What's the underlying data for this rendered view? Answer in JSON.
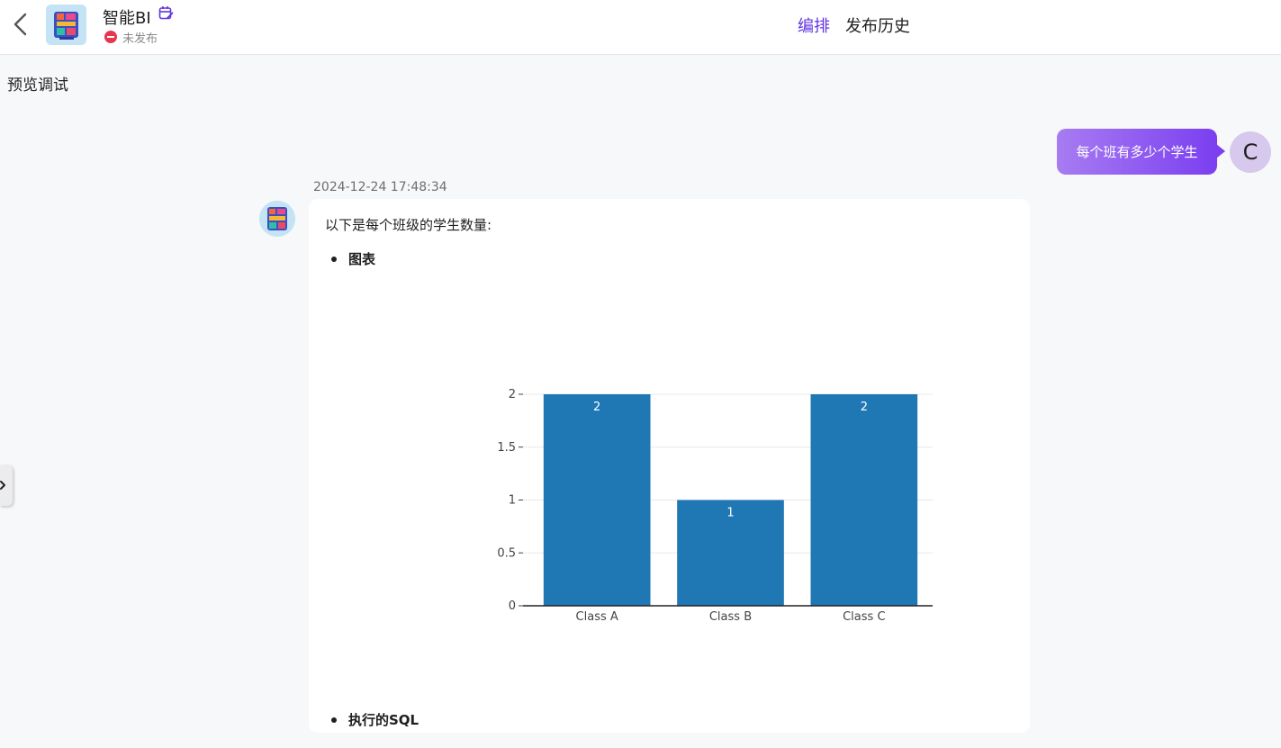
{
  "header": {
    "app_name": "智能BI",
    "status": "未发布",
    "tabs": [
      {
        "label": "编排",
        "active": true
      },
      {
        "label": "发布历史",
        "active": false
      }
    ],
    "accent_color": "#6236e0"
  },
  "panel": {
    "title": "预览调试"
  },
  "chat": {
    "user": {
      "avatar_letter": "C",
      "message": "每个班有多少个学生"
    },
    "bot": {
      "timestamp": "2024-12-24 17:48:34",
      "intro": "以下是每个班级的学生数量:",
      "bullets": [
        "图表",
        "执行的SQL"
      ]
    }
  },
  "chart_data": {
    "type": "bar",
    "categories": [
      "Class A",
      "Class B",
      "Class C"
    ],
    "values": [
      2,
      1,
      2
    ],
    "ylim": [
      0,
      2
    ],
    "yticks": [
      0,
      0.5,
      1,
      1.5,
      2
    ],
    "ytick_labels": [
      "0",
      "0.5",
      "1",
      "1.5",
      "2"
    ],
    "grid": true,
    "bar_color": "#1f77b4"
  }
}
